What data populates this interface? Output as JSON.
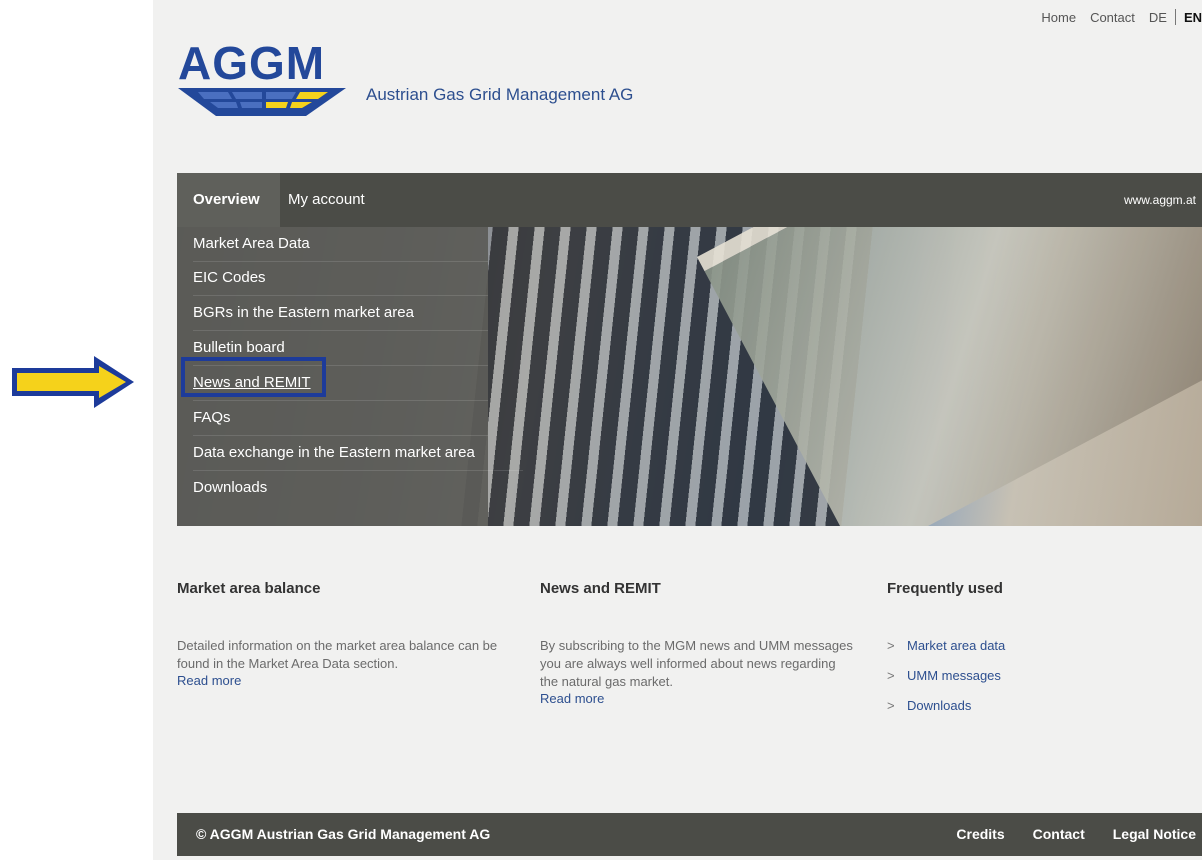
{
  "top_nav": {
    "home": "Home",
    "contact": "Contact",
    "lang_de": "DE",
    "lang_en": "EN"
  },
  "logo": {
    "text": "AGGM"
  },
  "company_name": "Austrian Gas Grid Management AG",
  "nav": {
    "tabs": [
      "Overview",
      "My account"
    ],
    "site_link": "www.aggm.at"
  },
  "dropdown": {
    "items": [
      "Market Area Data",
      "EIC Codes",
      "BGRs in the Eastern market area",
      "Bulletin board",
      "News and REMIT",
      "FAQs",
      "Data exchange in the Eastern market area",
      "Downloads"
    ]
  },
  "columns": {
    "balance": {
      "title": "Market area balance",
      "text": "Detailed information on the market area balance can be found in the Market Area Data section.",
      "read_more": "Read more"
    },
    "news": {
      "title": "News and REMIT",
      "text": "By subscribing to the MGM news and UMM messages you are always well informed about news regarding the natural gas market.",
      "read_more": "Read more"
    },
    "frequent": {
      "title": "Frequently used",
      "links": [
        "Market area data",
        "UMM messages",
        "Downloads"
      ]
    }
  },
  "footer": {
    "copyright": "© AGGM Austrian Gas Grid Management AG",
    "links": [
      "Credits",
      "Contact",
      "Legal Notice"
    ]
  },
  "colors": {
    "brand_blue": "#23489a",
    "nav_dark": "#4b4c47",
    "annotation_yellow": "#f5d21b",
    "annotation_blue": "#1d3b9a"
  }
}
